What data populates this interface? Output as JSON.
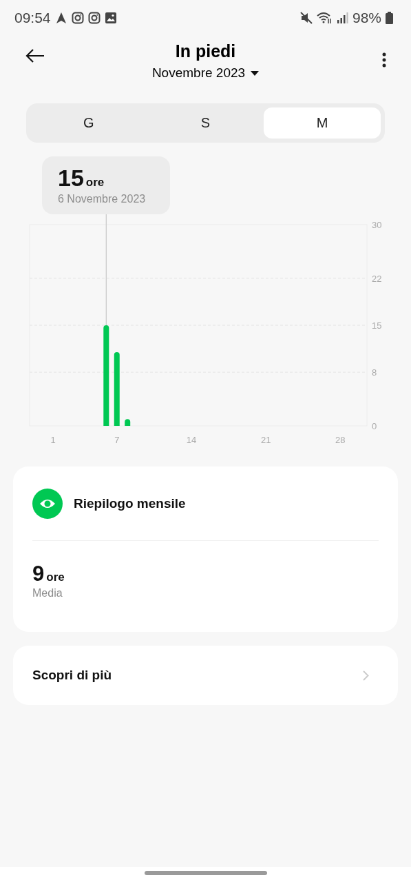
{
  "status_bar": {
    "time": "09:54",
    "battery": "98%"
  },
  "header": {
    "title": "In piedi",
    "period": "Novembre 2023"
  },
  "tabs": [
    {
      "label": "G",
      "selected": false
    },
    {
      "label": "S",
      "selected": false
    },
    {
      "label": "M",
      "selected": true
    }
  ],
  "tooltip": {
    "value": "15",
    "unit": "ore",
    "date": "6 Novembre 2023"
  },
  "chart": {
    "chart_data": {
      "type": "bar",
      "x": [
        1,
        2,
        3,
        4,
        5,
        6,
        7,
        8,
        9,
        10,
        11,
        12,
        13,
        14,
        15,
        16,
        17,
        18,
        19,
        20,
        21,
        22,
        23,
        24,
        25,
        26,
        27,
        28,
        29,
        30
      ],
      "grid": true,
      "series": [
        {
          "color": "#00c853",
          "values": [
            0,
            0,
            0,
            0,
            0,
            15,
            11,
            1,
            0,
            0,
            0,
            0,
            0,
            0,
            0,
            0,
            0,
            0,
            0,
            0,
            0,
            0,
            0,
            0,
            0,
            0,
            0,
            0,
            0,
            0
          ]
        }
      ],
      "xlim": [
        -1.2,
        30.5
      ],
      "ylim": [
        0,
        30
      ],
      "yticks": [
        0,
        8,
        15,
        22,
        30
      ],
      "xticks": [
        1,
        7,
        14,
        21,
        28
      ]
    }
  },
  "summary": {
    "title": "Riepilogo mensile",
    "value": "9",
    "unit": "ore",
    "label": "Media"
  },
  "more_link": {
    "label": "Scopri di più"
  }
}
